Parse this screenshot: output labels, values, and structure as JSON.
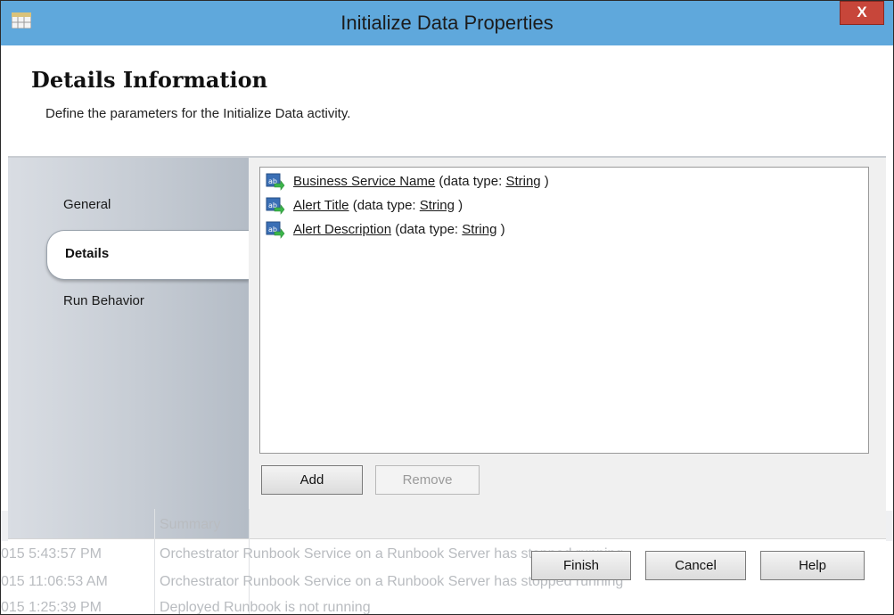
{
  "window": {
    "title": "Initialize Data Properties",
    "close_label": "X"
  },
  "header": {
    "title": "Details Information",
    "subtitle": "Define the parameters for the Initialize Data activity."
  },
  "sidebar": {
    "items": [
      {
        "label": "General",
        "selected": false
      },
      {
        "label": "Details",
        "selected": true
      },
      {
        "label": "Run Behavior",
        "selected": false
      }
    ]
  },
  "parameters": [
    {
      "name": "Business Service Name",
      "prefix": " (data type:  ",
      "type": "String",
      "suffix": " )",
      "icon": "parameter-icon"
    },
    {
      "name": "Alert Title",
      "prefix": " (data type:  ",
      "type": "String",
      "suffix": " )",
      "icon": "parameter-icon"
    },
    {
      "name": "Alert Description",
      "prefix": " (data type:  ",
      "type": "String",
      "suffix": " )",
      "icon": "parameter-icon"
    }
  ],
  "list_buttons": {
    "add_label": "Add",
    "remove_label": "Remove"
  },
  "dialog_buttons": {
    "finish_label": "Finish",
    "cancel_label": "Cancel",
    "help_label": "Help"
  },
  "background_window": {
    "column_header": "Summary",
    "rows": [
      {
        "time": "015 5:43:57 PM",
        "summary": "Orchestrator Runbook Service on a Runbook Server has stopped running"
      },
      {
        "time": "015 11:06:53 AM",
        "summary": "Orchestrator Runbook Service on a Runbook Server has stopped running"
      },
      {
        "time": "015 1:25:39 PM",
        "summary": "Deployed Runbook is not running"
      }
    ]
  },
  "colors": {
    "titlebar": "#5fa8dc",
    "close_button": "#c7463a",
    "sidebar_gradient_start": "#d9dde3",
    "sidebar_gradient_end": "#b4bcc6"
  }
}
